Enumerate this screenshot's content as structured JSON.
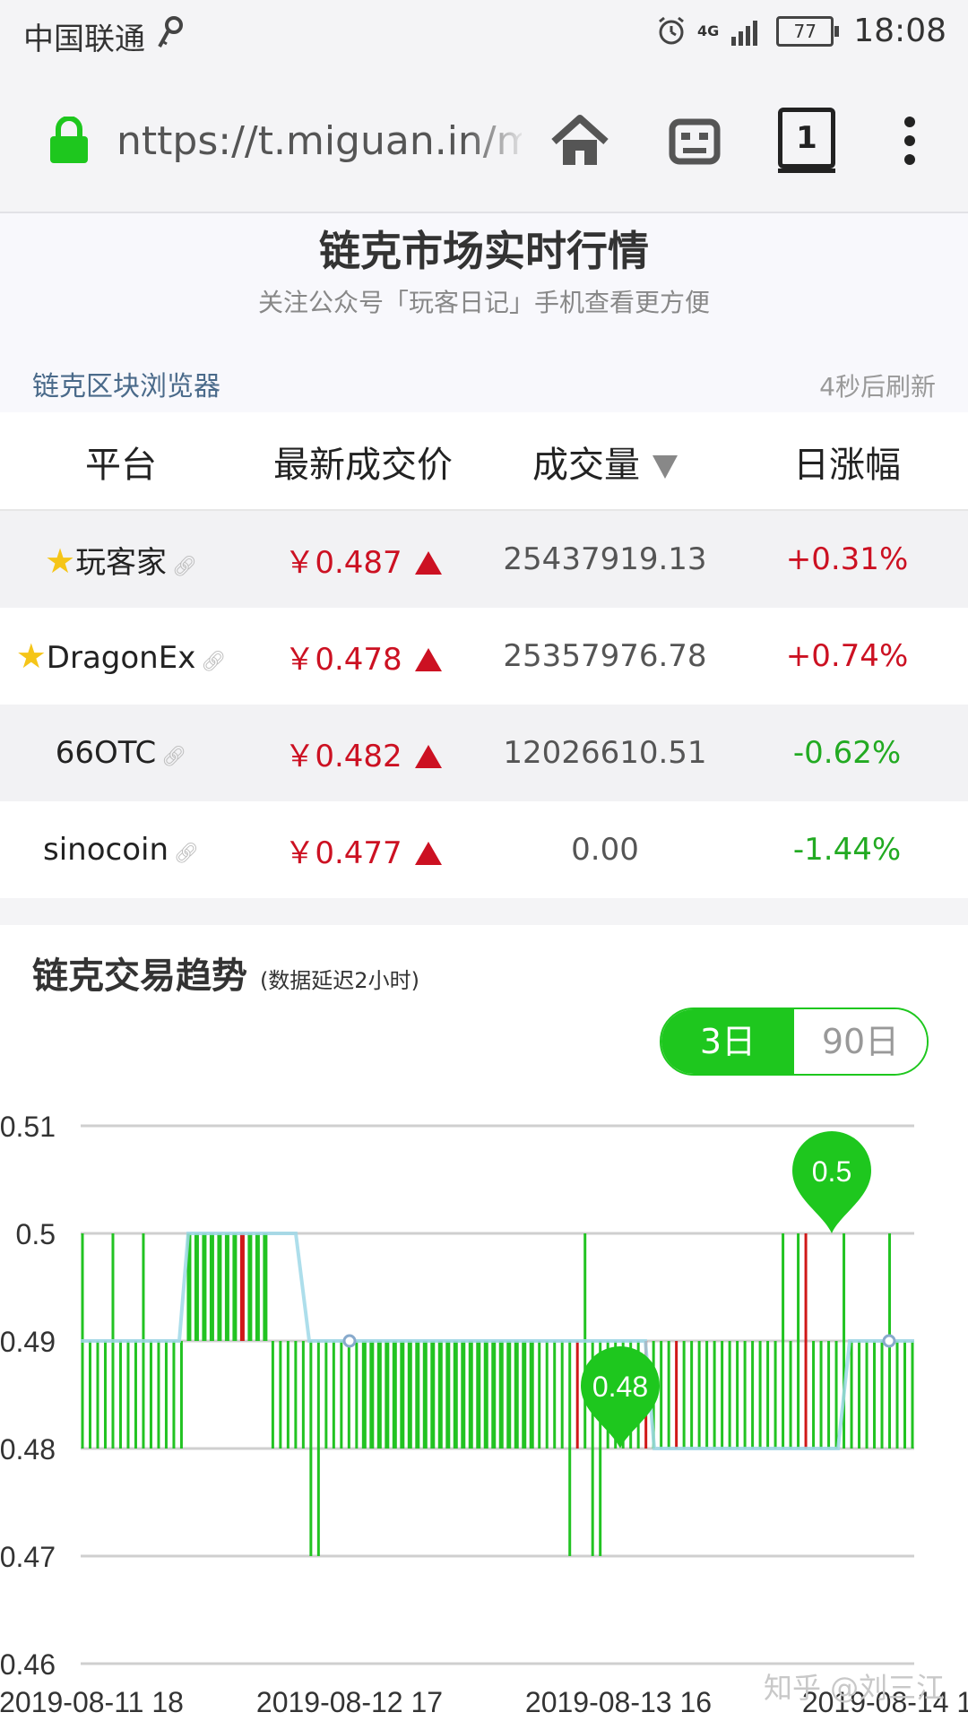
{
  "status_bar": {
    "carrier": "中国联通",
    "network": "4G",
    "battery": "77",
    "time": "18:08"
  },
  "browser": {
    "url": "nttps://t.miguan.in/m",
    "tab_count": "1"
  },
  "header": {
    "title": "链克市场实时行情",
    "subtitle": "关注公众号「玩客日记」手机查看更方便",
    "explorer_link": "链克区块浏览器",
    "refresh_text": "4秒后刷新"
  },
  "table": {
    "columns": [
      "平台",
      "最新成交价",
      "成交量",
      "日涨幅"
    ],
    "rows": [
      {
        "starred": true,
        "platform": "玩客家",
        "price": "￥0.487",
        "volume": "25437919.13",
        "change": "+0.31%",
        "direction": "up"
      },
      {
        "starred": true,
        "platform": "DragonEx",
        "price": "￥0.478",
        "volume": "25357976.78",
        "change": "+0.74%",
        "direction": "up"
      },
      {
        "starred": false,
        "platform": "66OTC",
        "price": "￥0.482",
        "volume": "12026610.51",
        "change": "-0.62%",
        "direction": "down"
      },
      {
        "starred": false,
        "platform": "sinocoin",
        "price": "￥0.477",
        "volume": "0.00",
        "change": "-1.44%",
        "direction": "down"
      }
    ]
  },
  "trend": {
    "title": "链克交易趋势",
    "note": "(数据延迟2小时)",
    "ranges": [
      "3日",
      "90日"
    ],
    "active_range": "3日"
  },
  "chart_data": {
    "type": "bar",
    "yticks": [
      "0.51",
      "0.5",
      "0.49",
      "0.48",
      "0.47",
      "0.46"
    ],
    "xticks": [
      "2019-08-11 18",
      "2019-08-12 17",
      "2019-08-13 16",
      "2019-08-14 1"
    ],
    "ylim": [
      0.46,
      0.51
    ],
    "baseline": 0.49,
    "markers": [
      {
        "label": "0.48",
        "value": 0.48
      },
      {
        "label": "0.5",
        "value": 0.5
      }
    ],
    "up_color": "#22c322",
    "down_color": "#d01818",
    "line_color": "#9fd8e8"
  },
  "watermark": "知乎 @刘三江",
  "colors": {
    "accent_green": "#1ec71e",
    "price_red": "#cc1122",
    "negative_green": "#22aa22"
  }
}
